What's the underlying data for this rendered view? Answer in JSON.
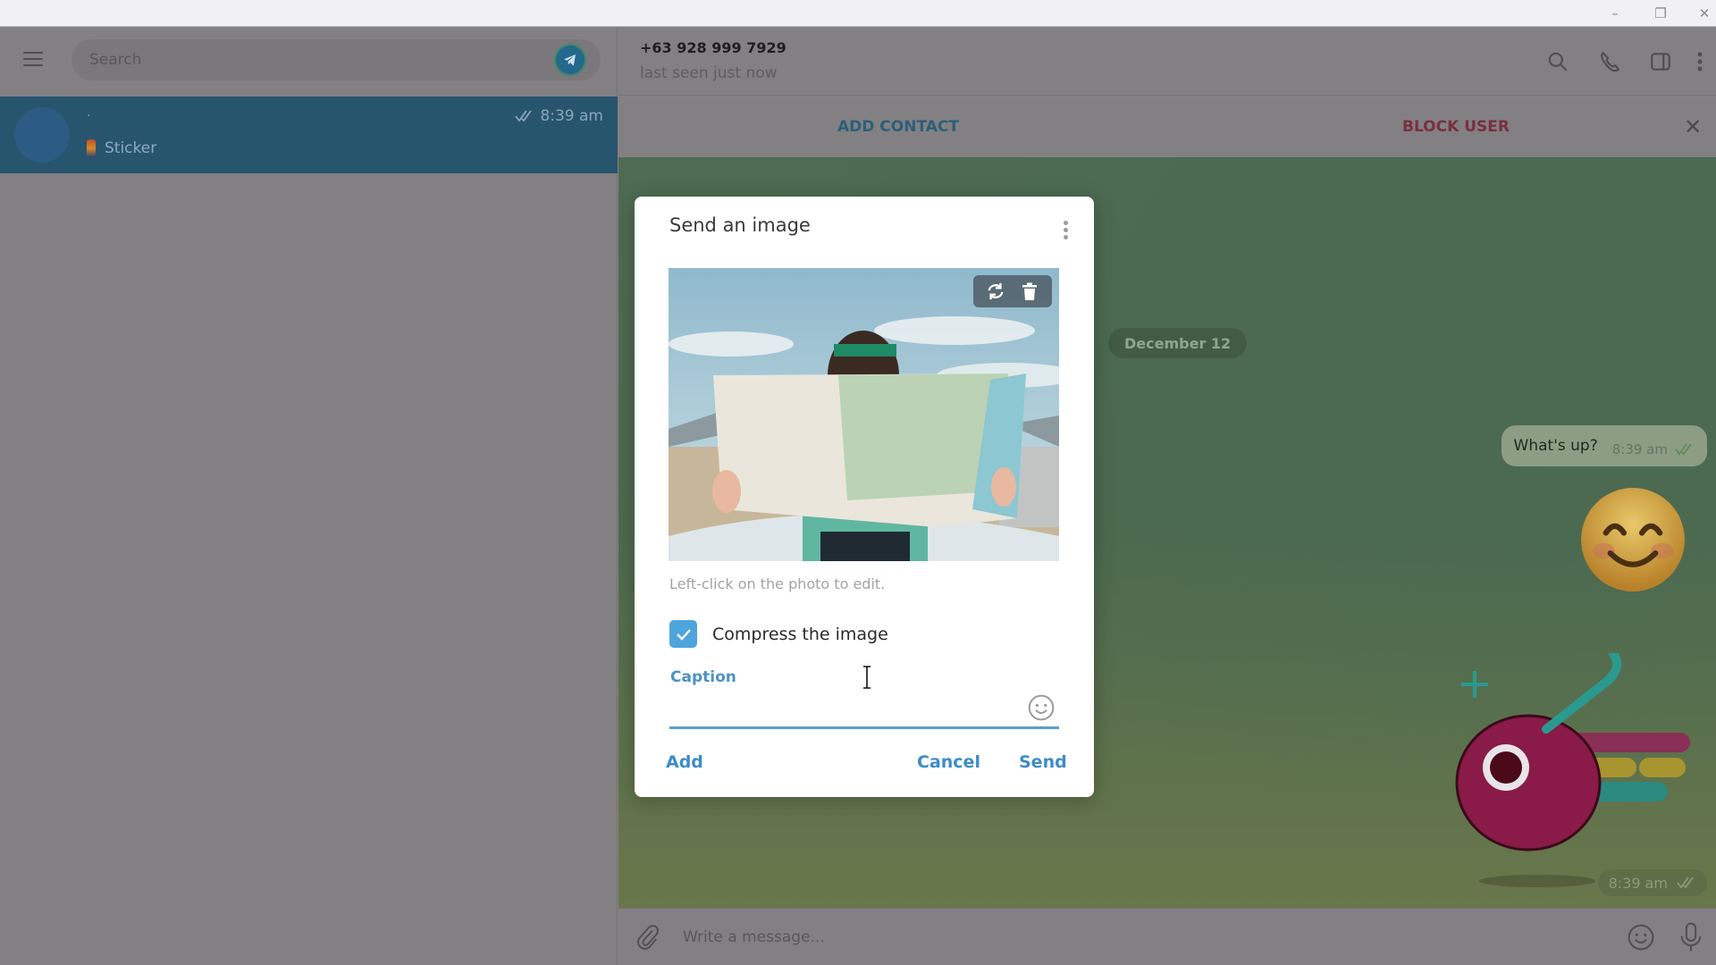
{
  "window": {
    "controls": {
      "minimize": "–",
      "maximize": "❐",
      "close": "✕"
    }
  },
  "sidebar": {
    "search": {
      "placeholder": "Search",
      "value": ""
    },
    "chats": [
      {
        "name": "·",
        "time": "8:39 am",
        "status": "read",
        "preview": "Sticker",
        "selected": true
      }
    ]
  },
  "chat": {
    "peer_name": "+63 928 999 7929",
    "peer_status": "last seen just now",
    "actions": {
      "add_contact": "ADD CONTACT",
      "block_user": "BLOCK USER"
    },
    "date_badge": "December 12",
    "messages": [
      {
        "type": "text",
        "text": "What's up?",
        "time": "8:39 am",
        "status": "read"
      },
      {
        "type": "emoji-sticker",
        "emoji": "smiling-face-with-smiling-eyes"
      },
      {
        "type": "sticker",
        "name": "cherry",
        "time": "8:39 am",
        "status": "read"
      }
    ],
    "composer": {
      "placeholder": "Write a message...",
      "value": ""
    }
  },
  "dialog": {
    "title": "Send an image",
    "hint": "Left-click on the photo to edit.",
    "compress": {
      "label": "Compress the image",
      "checked": true
    },
    "caption": {
      "label": "Caption",
      "value": ""
    },
    "buttons": {
      "add": "Add",
      "cancel": "Cancel",
      "send": "Send"
    }
  },
  "colors": {
    "accent": "#4ea4dd",
    "link": "#3d8cc6",
    "block": "#7a2f3e",
    "selected_chat": "#27556e"
  }
}
